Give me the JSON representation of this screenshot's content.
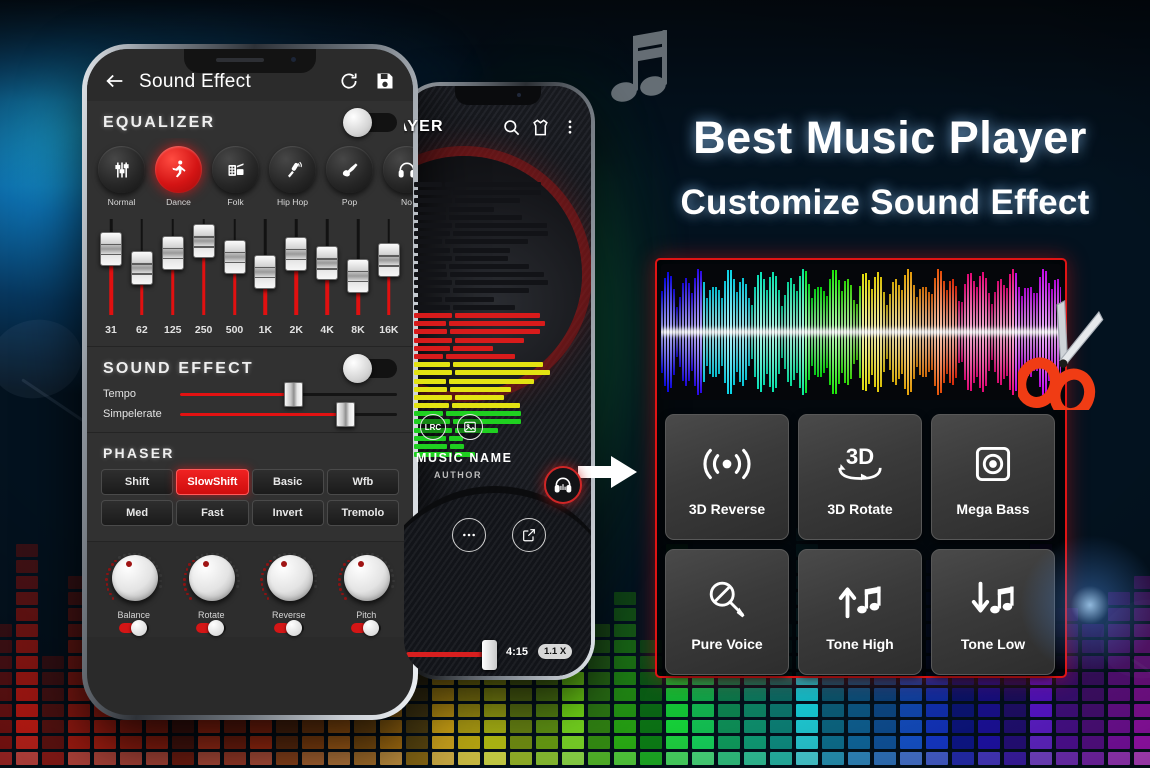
{
  "background": {
    "type": "music-equalizer-bars-stage-lights",
    "colors": {
      "left_glow": "#1fb6e8",
      "right_glow": "#1ea7e0",
      "center_glow": "#0d7a3c"
    }
  },
  "decorations": {
    "music_note_icon": "music-note-icon",
    "turntable_icon": "turntable-icon",
    "arrow_icon": "right-arrow-icon",
    "scissors_icon": "scissors-icon"
  },
  "promo": {
    "headline": "Best Music Player",
    "subheadline": "Customize Sound Effect"
  },
  "effects_panel": {
    "waveform": {
      "label": "audio-waveform",
      "cut_tool": "scissors"
    },
    "tiles": [
      {
        "label": "3D Reverse",
        "icon": "sound-waves-icon"
      },
      {
        "label": "3D Rotate",
        "icon": "3d-rotate-icon",
        "icon_text": "3D"
      },
      {
        "label": "Mega Bass",
        "icon": "speaker-square-icon"
      },
      {
        "label": "Pure Voice",
        "icon": "microphone-muted-icon"
      },
      {
        "label": "Tone High",
        "icon": "arrow-up-note-icon"
      },
      {
        "label": "Tone Low",
        "icon": "arrow-down-note-icon"
      }
    ]
  },
  "phone_sound_effect": {
    "appbar": {
      "back_icon": "back-arrow-icon",
      "title": "Sound Effect",
      "reset_icon": "refresh-icon",
      "save_icon": "save-disk-icon"
    },
    "equalizer": {
      "title": "EQUALIZER",
      "enabled": true,
      "presets": [
        {
          "label": "Normal",
          "icon": "sliders-icon",
          "active": false
        },
        {
          "label": "Dance",
          "icon": "dancer-icon",
          "active": true
        },
        {
          "label": "Folk",
          "icon": "accordion-icon",
          "active": false
        },
        {
          "label": "Hip Hop",
          "icon": "microphone-icon",
          "active": false
        },
        {
          "label": "Pop",
          "icon": "guitar-icon",
          "active": false
        },
        {
          "label": "No",
          "icon": "headphone-icon",
          "active": false
        }
      ],
      "bands": [
        {
          "freq": "31",
          "value": 72
        },
        {
          "freq": "62",
          "value": 52
        },
        {
          "freq": "125",
          "value": 68
        },
        {
          "freq": "250",
          "value": 80
        },
        {
          "freq": "500",
          "value": 64
        },
        {
          "freq": "1K",
          "value": 48
        },
        {
          "freq": "2K",
          "value": 67
        },
        {
          "freq": "4K",
          "value": 57
        },
        {
          "freq": "8K",
          "value": 44
        },
        {
          "freq": "16K",
          "value": 60
        }
      ]
    },
    "sound_effect": {
      "title": "SOUND EFFECT",
      "enabled": true,
      "sliders": [
        {
          "label": "Tempo",
          "value": 52
        },
        {
          "label": "Simpelerate",
          "value": 76
        }
      ]
    },
    "phaser": {
      "title": "PHASER",
      "rows": [
        [
          {
            "label": "Shift",
            "active": false
          },
          {
            "label": "SlowShift",
            "active": true
          },
          {
            "label": "Basic",
            "active": false
          },
          {
            "label": "Wfb",
            "active": false
          }
        ],
        [
          {
            "label": "Med",
            "active": false
          },
          {
            "label": "Fast",
            "active": false
          },
          {
            "label": "Invert",
            "active": false
          },
          {
            "label": "Tremolo",
            "active": false
          }
        ]
      ]
    },
    "knobs": [
      {
        "label": "Balance",
        "enabled": true
      },
      {
        "label": "Rotate",
        "enabled": true
      },
      {
        "label": "Reverse",
        "enabled": true
      },
      {
        "label": "Pitch",
        "enabled": true
      }
    ]
  },
  "phone_player": {
    "appbar": {
      "title": "AYER",
      "search_icon": "search-icon",
      "theme_icon": "shirt-icon",
      "menu_icon": "more-vertical-icon"
    },
    "badges": [
      {
        "label": "LRC",
        "icon": "lyrics-icon"
      },
      {
        "label": "",
        "icon": "image-icon"
      }
    ],
    "track": {
      "name": "MUSIC NAME",
      "author": "AUTHOR"
    },
    "equalizer_button_icon": "headphone-eq-icon",
    "progress": {
      "time": "4:15",
      "speed": "1.1 X",
      "percent": 46
    },
    "controls": [
      {
        "icon": "play-icon",
        "name": "play-button"
      },
      {
        "icon": "next-icon",
        "name": "next-button"
      },
      {
        "icon": "playlist-icon",
        "name": "playlist-button"
      }
    ],
    "more_icon": "more-horizontal-icon",
    "share_icon": "share-icon"
  }
}
